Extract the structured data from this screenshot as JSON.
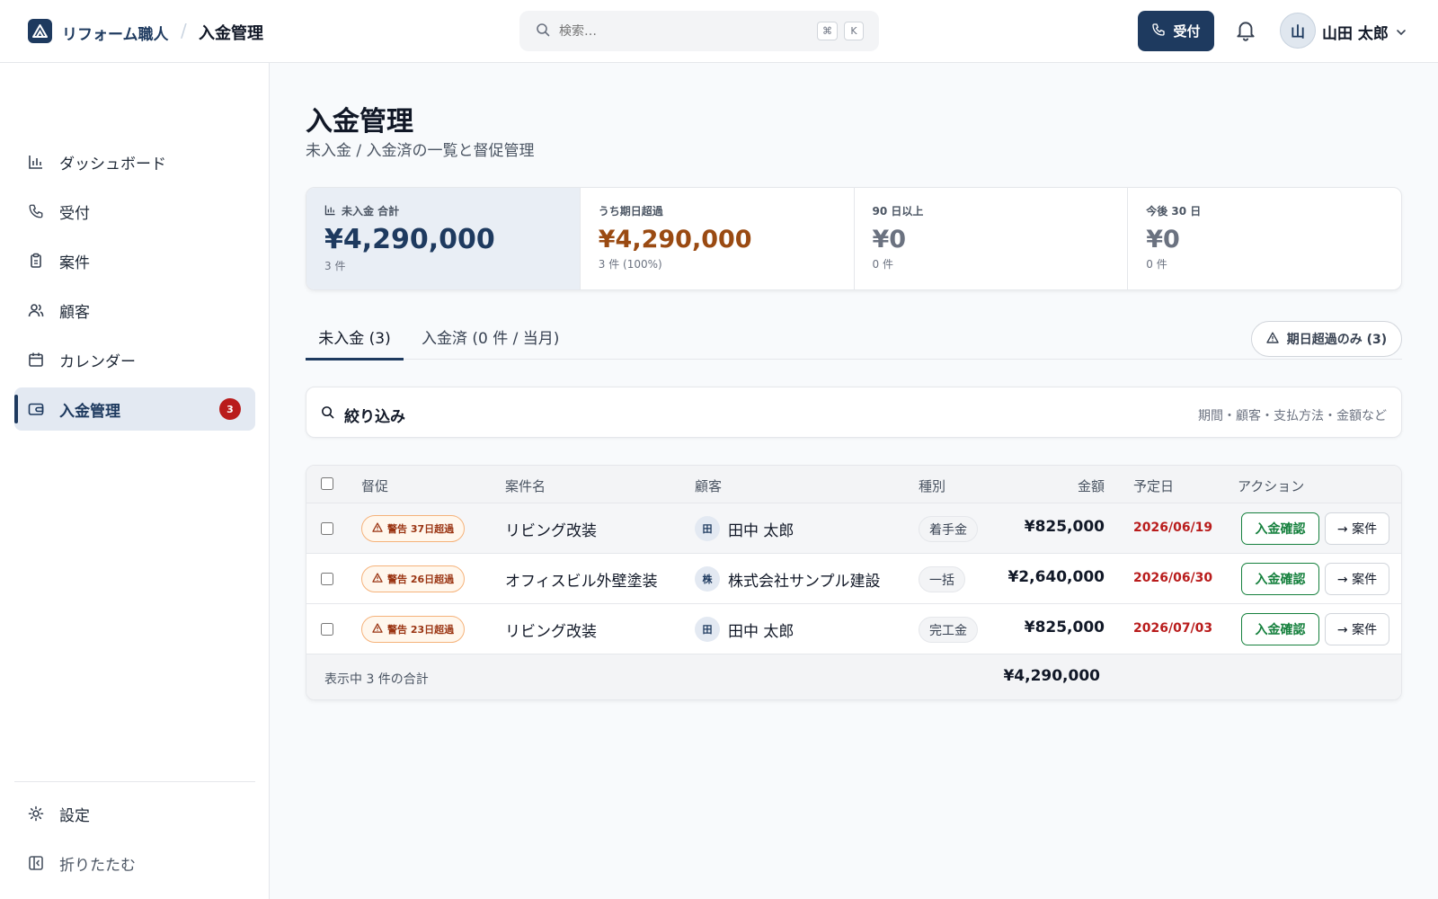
{
  "brand": {
    "name": "リフォーム職人"
  },
  "breadcrumb": {
    "current": "入金管理"
  },
  "search": {
    "placeholder": "検索…",
    "kbd_1": "⌘",
    "kbd_2": "K"
  },
  "header": {
    "receive_label": "受付",
    "user_initial": "山",
    "user_name": "山田 太郎"
  },
  "sidebar": {
    "items": [
      {
        "label": "ダッシュボード",
        "icon": "bar-chart-icon"
      },
      {
        "label": "受付",
        "icon": "phone-icon"
      },
      {
        "label": "案件",
        "icon": "clipboard-icon"
      },
      {
        "label": "顧客",
        "icon": "users-icon"
      },
      {
        "label": "カレンダー",
        "icon": "calendar-icon"
      },
      {
        "label": "入金管理",
        "icon": "wallet-icon",
        "badge": "3",
        "active": true
      }
    ],
    "settings_label": "設定",
    "collapse_label": "折りたたむ"
  },
  "page": {
    "title": "入金管理",
    "subtitle": "未入金 / 入金済の一覧と督促管理"
  },
  "kpis": [
    {
      "label": "未入金 合計",
      "value": "¥4,290,000",
      "sub": "3 件",
      "color": "#1e3a5f"
    },
    {
      "label": "うち期日超過",
      "value": "¥4,290,000",
      "sub": "3 件 (100%)",
      "color": "#9a4a12"
    },
    {
      "label": "90 日以上",
      "value": "¥0",
      "sub": "0 件",
      "color": "#6b7280"
    },
    {
      "label": "今後 30 日",
      "value": "¥0",
      "sub": "0 件",
      "color": "#6b7280"
    }
  ],
  "tabs": [
    {
      "label": "未入金 (3)",
      "active": true
    },
    {
      "label": "入金済 (0 件 / 当月)",
      "active": false
    }
  ],
  "overdue_filter": {
    "label": "期日超過のみ (3)"
  },
  "filter": {
    "label": "絞り込み",
    "hint": "期間・顧客・支払方法・金額など"
  },
  "table": {
    "headers": {
      "reminder": "督促",
      "project": "案件名",
      "customer": "顧客",
      "type": "種別",
      "amount": "金額",
      "due": "予定日",
      "action": "アクション"
    },
    "rows": [
      {
        "warning": "警告 37日超過",
        "project": "リビング改装",
        "customer_initial": "田",
        "customer": "田中 太郎",
        "type": "着手金",
        "amount": "¥825,000",
        "due": "2026/06/19",
        "confirm_label": "入金確認",
        "case_label": "→ 案件"
      },
      {
        "warning": "警告 26日超過",
        "project": "オフィスビル外壁塗装",
        "customer_initial": "株",
        "customer": "株式会社サンプル建設",
        "type": "一括",
        "amount": "¥2,640,000",
        "due": "2026/06/30",
        "confirm_label": "入金確認",
        "case_label": "→ 案件"
      },
      {
        "warning": "警告 23日超過",
        "project": "リビング改装",
        "customer_initial": "田",
        "customer": "田中 太郎",
        "type": "完工金",
        "amount": "¥825,000",
        "due": "2026/07/03",
        "confirm_label": "入金確認",
        "case_label": "→ 案件"
      }
    ],
    "footer_label": "表示中 3 件の合計",
    "footer_total": "¥4,290,000"
  }
}
